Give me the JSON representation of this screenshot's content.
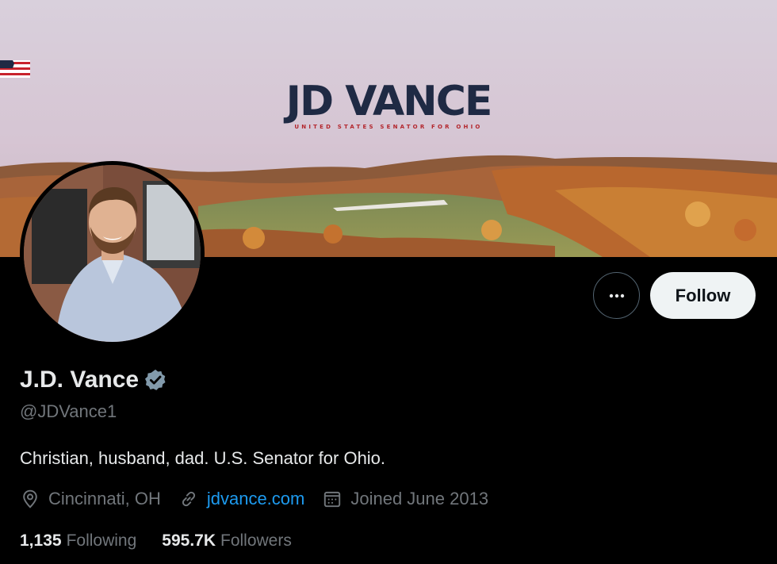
{
  "banner": {
    "title": "JD VANCE",
    "subtitle": "UNITED STATES SENATOR FOR OHIO"
  },
  "actions": {
    "more_label": "•••",
    "follow_label": "Follow"
  },
  "profile": {
    "display_name": "J.D. Vance",
    "verified": true,
    "handle": "@JDVance1",
    "bio": "Christian, husband, dad. U.S. Senator for Ohio.",
    "location": "Cincinnati, OH",
    "website": "jdvance.com",
    "joined": "Joined June 2013"
  },
  "stats": {
    "following_count": "1,135",
    "following_label": "Following",
    "followers_count": "595.7K",
    "followers_label": "Followers"
  },
  "icons": {
    "location": "location-pin-icon",
    "link": "link-icon",
    "calendar": "calendar-icon",
    "verified": "verified-badge-icon",
    "more": "more-dots-icon"
  },
  "colors": {
    "background": "#000000",
    "primary_text": "#e7e9ea",
    "secondary_text": "#71767b",
    "link": "#1d9bf0",
    "follow_button_bg": "#eff3f4",
    "verified_badge": "#829aab"
  }
}
